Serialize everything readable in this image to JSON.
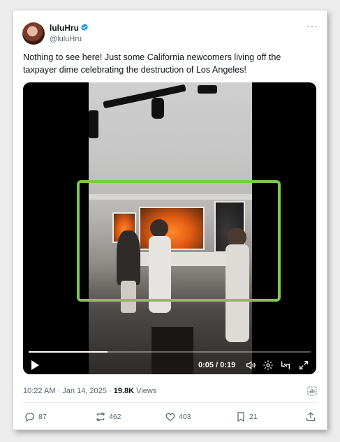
{
  "author": {
    "display_name": "luluHru",
    "handle": "@luluHru",
    "verified": true
  },
  "tweet_text": "Nothing to see here! Just some California newcomers living off the taxpayer dime celebrating the destruction of Los Angeles!",
  "video": {
    "current_time": "0:05",
    "duration": "0:19",
    "time_display": "0:05 / 0:19",
    "progress": 0.28,
    "highlight_color": "#7dc650"
  },
  "meta": {
    "time": "10:22 AM",
    "date": "Jan 14, 2025",
    "views_count": "19.8K",
    "views_label": "Views"
  },
  "actions": {
    "replies": "87",
    "reposts": "462",
    "likes": "403",
    "bookmarks": "21"
  },
  "colors": {
    "verified": "#1d9bf0",
    "text": "#0f1419",
    "muted": "#536471"
  },
  "icons": [
    "more-icon",
    "verified-icon",
    "play-icon",
    "volume-icon",
    "settings-icon",
    "pip-icon",
    "fullscreen-icon",
    "analytics-icon",
    "reply-icon",
    "repost-icon",
    "like-icon",
    "bookmark-icon",
    "share-icon"
  ]
}
